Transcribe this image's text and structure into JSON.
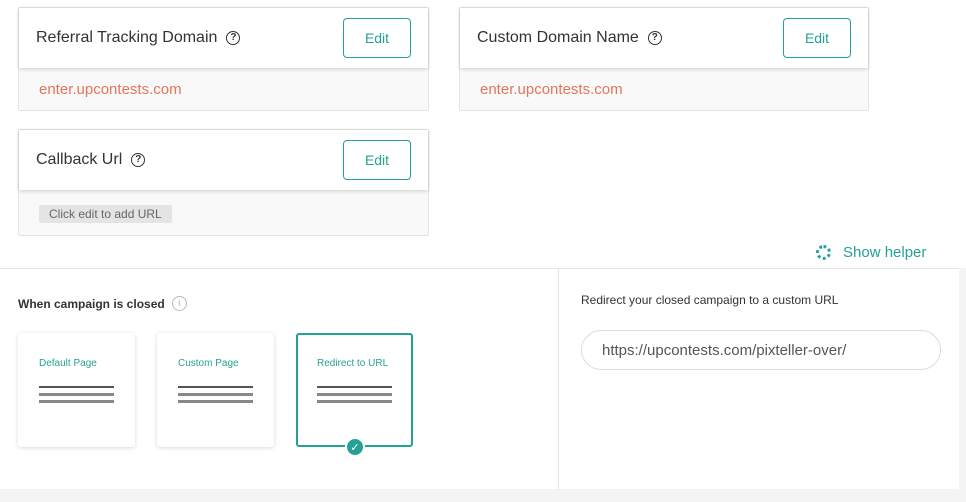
{
  "cards": {
    "referral": {
      "title": "Referral Tracking Domain",
      "help": "?",
      "edit": "Edit",
      "value": "enter.upcontests.com"
    },
    "custom_domain": {
      "title": "Custom Domain Name",
      "help": "?",
      "edit": "Edit",
      "value": "enter.upcontests.com"
    },
    "callback": {
      "title": "Callback Url",
      "help": "?",
      "edit": "Edit",
      "hint": "Click edit to add URL"
    }
  },
  "helper": {
    "label": "Show helper",
    "icon": "lifebuoy-icon"
  },
  "closed": {
    "label": "When campaign is closed",
    "info": "i",
    "options": [
      {
        "label": "Default Page",
        "selected": false
      },
      {
        "label": "Custom Page",
        "selected": false
      },
      {
        "label": "Redirect to URL",
        "selected": true
      }
    ],
    "check": "✓"
  },
  "redirect": {
    "label": "Redirect your closed campaign to a custom URL",
    "url": "https://upcontests.com/pixteller-over/"
  },
  "colors": {
    "accent": "#26a195",
    "value_text": "#e2775a"
  }
}
